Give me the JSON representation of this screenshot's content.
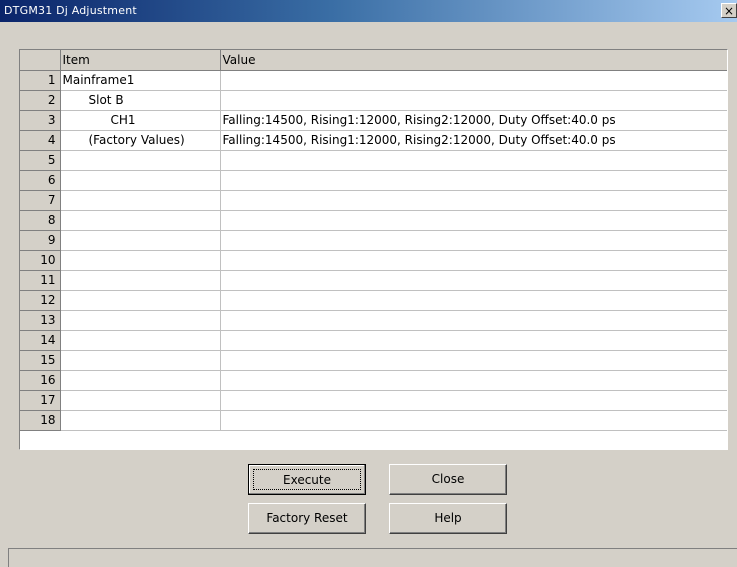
{
  "window": {
    "title": "DTGM31 Dj Adjustment",
    "close_glyph": "×"
  },
  "grid": {
    "columns": [
      "",
      "Item",
      "Value"
    ],
    "rows": [
      {
        "num": "1",
        "item": "Mainframe1",
        "value": "",
        "indent": 0
      },
      {
        "num": "2",
        "item": "Slot B",
        "value": "",
        "indent": 1
      },
      {
        "num": "3",
        "item": "CH1",
        "value": "Falling:14500, Rising1:12000, Rising2:12000, Duty Offset:40.0 ps",
        "indent": 2
      },
      {
        "num": "4",
        "item": "(Factory Values)",
        "value": "Falling:14500, Rising1:12000, Rising2:12000, Duty Offset:40.0 ps",
        "indent": 3
      },
      {
        "num": "5",
        "item": "",
        "value": "",
        "indent": 0
      },
      {
        "num": "6",
        "item": "",
        "value": "",
        "indent": 0
      },
      {
        "num": "7",
        "item": "",
        "value": "",
        "indent": 0
      },
      {
        "num": "8",
        "item": "",
        "value": "",
        "indent": 0
      },
      {
        "num": "9",
        "item": "",
        "value": "",
        "indent": 0
      },
      {
        "num": "10",
        "item": "",
        "value": "",
        "indent": 0
      },
      {
        "num": "11",
        "item": "",
        "value": "",
        "indent": 0
      },
      {
        "num": "12",
        "item": "",
        "value": "",
        "indent": 0
      },
      {
        "num": "13",
        "item": "",
        "value": "",
        "indent": 0
      },
      {
        "num": "14",
        "item": "",
        "value": "",
        "indent": 0
      },
      {
        "num": "15",
        "item": "",
        "value": "",
        "indent": 0
      },
      {
        "num": "16",
        "item": "",
        "value": "",
        "indent": 0
      },
      {
        "num": "17",
        "item": "",
        "value": "",
        "indent": 0
      },
      {
        "num": "18",
        "item": "",
        "value": "",
        "indent": 0
      }
    ]
  },
  "buttons": {
    "execute": "Execute",
    "close": "Close",
    "factory_reset": "Factory Reset",
    "help": "Help"
  },
  "status": {
    "text": ""
  }
}
